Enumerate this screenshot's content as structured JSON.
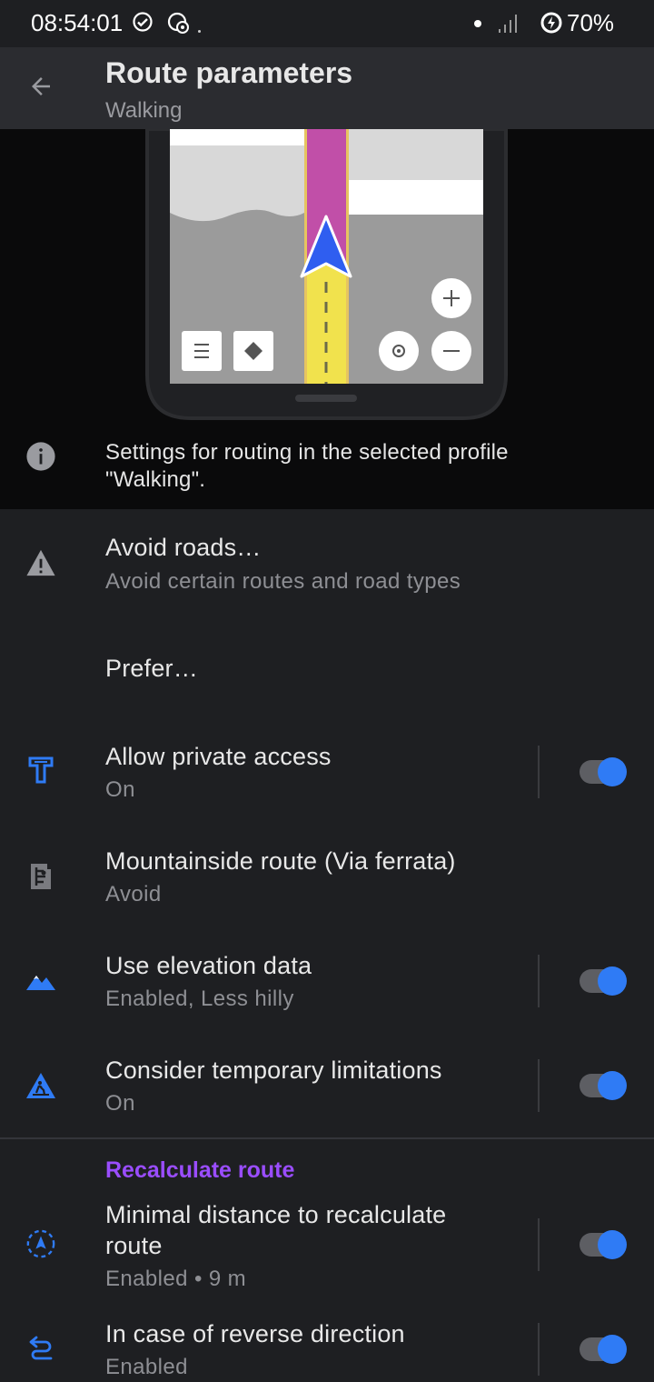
{
  "status_bar": {
    "time": "08:54:01",
    "battery": "70%",
    "icons": [
      "check-circle-icon",
      "app-notification-icon",
      "signal-icon",
      "battery-saver-icon"
    ]
  },
  "app_bar": {
    "title": "Route parameters",
    "subtitle": "Walking",
    "back_icon": "arrow-left-icon"
  },
  "info": {
    "text": "Settings for routing in the selected profile \"Walking\".",
    "icon": "info-icon"
  },
  "items": [
    {
      "title": "Avoid roads…",
      "subtitle": "Avoid certain routes and road types",
      "icon": "warning-icon"
    },
    {
      "title": "Prefer…"
    },
    {
      "title": "Allow private access",
      "subtitle": "On",
      "icon": "private-access-icon",
      "toggle": true
    },
    {
      "title": "Mountainside route (Via ferrata)",
      "subtitle": "Avoid",
      "icon": "via-ferrata-icon"
    },
    {
      "title": "Use elevation data",
      "subtitle": "Enabled, Less hilly",
      "icon": "mountain-icon",
      "toggle": true
    },
    {
      "title": "Consider temporary limitations",
      "subtitle": "On",
      "icon": "road-works-icon",
      "toggle": true
    }
  ],
  "recalc": {
    "section_title": "Recalculate route",
    "items": [
      {
        "title_line1": "Minimal distance to recalculate",
        "title_line2": "route",
        "subtitle": "Enabled • 9 m",
        "icon": "recalculate-distance-icon",
        "toggle": true
      },
      {
        "title": "In case of reverse direction",
        "subtitle": "Enabled",
        "icon": "reverse-direction-icon",
        "toggle": true
      }
    ]
  },
  "colors": {
    "accent": "#2f7bf5",
    "section": "#9a4dff",
    "background": "#1e1f22",
    "app_bar": "#2b2c30"
  }
}
